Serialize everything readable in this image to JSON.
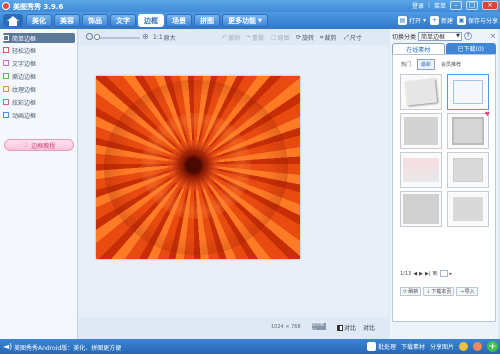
{
  "window": {
    "title": "美图秀秀 3.9.6",
    "login": "登录",
    "menu": "菜单"
  },
  "tabs": [
    {
      "label": "美化",
      "active": false
    },
    {
      "label": "美容",
      "active": false
    },
    {
      "label": "饰品",
      "active": false
    },
    {
      "label": "文字",
      "active": false
    },
    {
      "label": "边框",
      "active": true
    },
    {
      "label": "场景",
      "active": false
    },
    {
      "label": "拼图",
      "active": false
    },
    {
      "label": "更多功能",
      "active": false
    }
  ],
  "file_actions": {
    "open": "打开",
    "new": "新建",
    "save": "保存与分享"
  },
  "left_panel": {
    "items": [
      {
        "label": "简单边框",
        "active": true
      },
      {
        "label": "轻松边框",
        "active": false
      },
      {
        "label": "文字边框",
        "active": false
      },
      {
        "label": "撕边边框",
        "active": false
      },
      {
        "label": "纹理边框",
        "active": false
      },
      {
        "label": "炫彩边框",
        "active": false
      },
      {
        "label": "动画边框",
        "active": false
      }
    ],
    "tutorial": "边框教程"
  },
  "toolbar": {
    "zoom_reset": "1:1",
    "actual_size": "原大",
    "undo": "撤销",
    "redo": "重做",
    "reset": "原图",
    "rotate": "旋转",
    "crop": "裁剪",
    "resize": "尺寸"
  },
  "canvas": {
    "dimensions": "1024 × 768",
    "fit_label": "适合窗口",
    "contrast": "对比",
    "compare": "对比"
  },
  "right_panel": {
    "category_label": "切换分类",
    "category_value": "简单边框",
    "help": "?",
    "tabs": [
      {
        "label": "在线素材",
        "active": true
      },
      {
        "label": "已下载(0)",
        "active": false
      }
    ],
    "subtabs": [
      {
        "label": "热门",
        "active": false
      },
      {
        "label": "最新",
        "active": true
      },
      {
        "label": "会员推荐",
        "active": false
      }
    ],
    "pager": {
      "current": "1/13",
      "go": "到"
    },
    "actions": {
      "refresh": "刷新",
      "download_page": "下载本页",
      "import": "导入"
    }
  },
  "statusbar": {
    "ad_text": "美图秀秀Android版：美化、拼图更方便",
    "batch": "批处理",
    "download": "下载素材",
    "share": "分享图片"
  }
}
